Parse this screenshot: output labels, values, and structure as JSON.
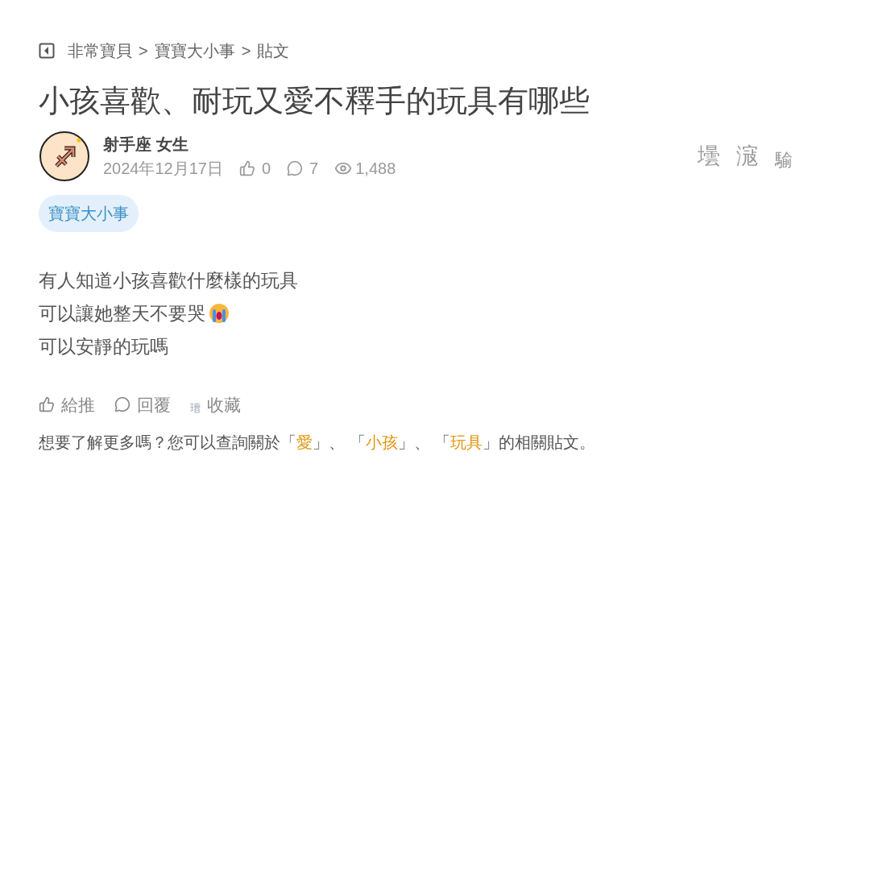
{
  "breadcrumb": [
    "非常寶貝",
    "寶寶大小事",
    "貼文"
  ],
  "breadcrumb_separator": ">",
  "title": "小孩喜歡、耐玩又愛不釋手的玩具有哪些",
  "author": {
    "name": "射手座 女生",
    "date": "2024年12月17日",
    "likes": "0",
    "comments": "7",
    "views": "1,488"
  },
  "side_glyphs": [
    "壜",
    "滱",
    "騟"
  ],
  "tag": "寶寶大小事",
  "body": [
    "有人知道小孩喜歡什麼樣的玩具",
    "可以讓她整天不要哭",
    "可以安靜的玩嗎"
  ],
  "actions": [
    {
      "kind": "like",
      "label": "給推"
    },
    {
      "kind": "reply",
      "label": "回覆"
    },
    {
      "kind": "save",
      "glyph": "瑨",
      "label": "收藏"
    }
  ],
  "related": {
    "before": "想要了解更多嗎？您可以查詢關於「",
    "links": [
      "愛",
      "小孩",
      "玩具"
    ],
    "between": "」、 「",
    "after": "」的相關貼文。"
  }
}
